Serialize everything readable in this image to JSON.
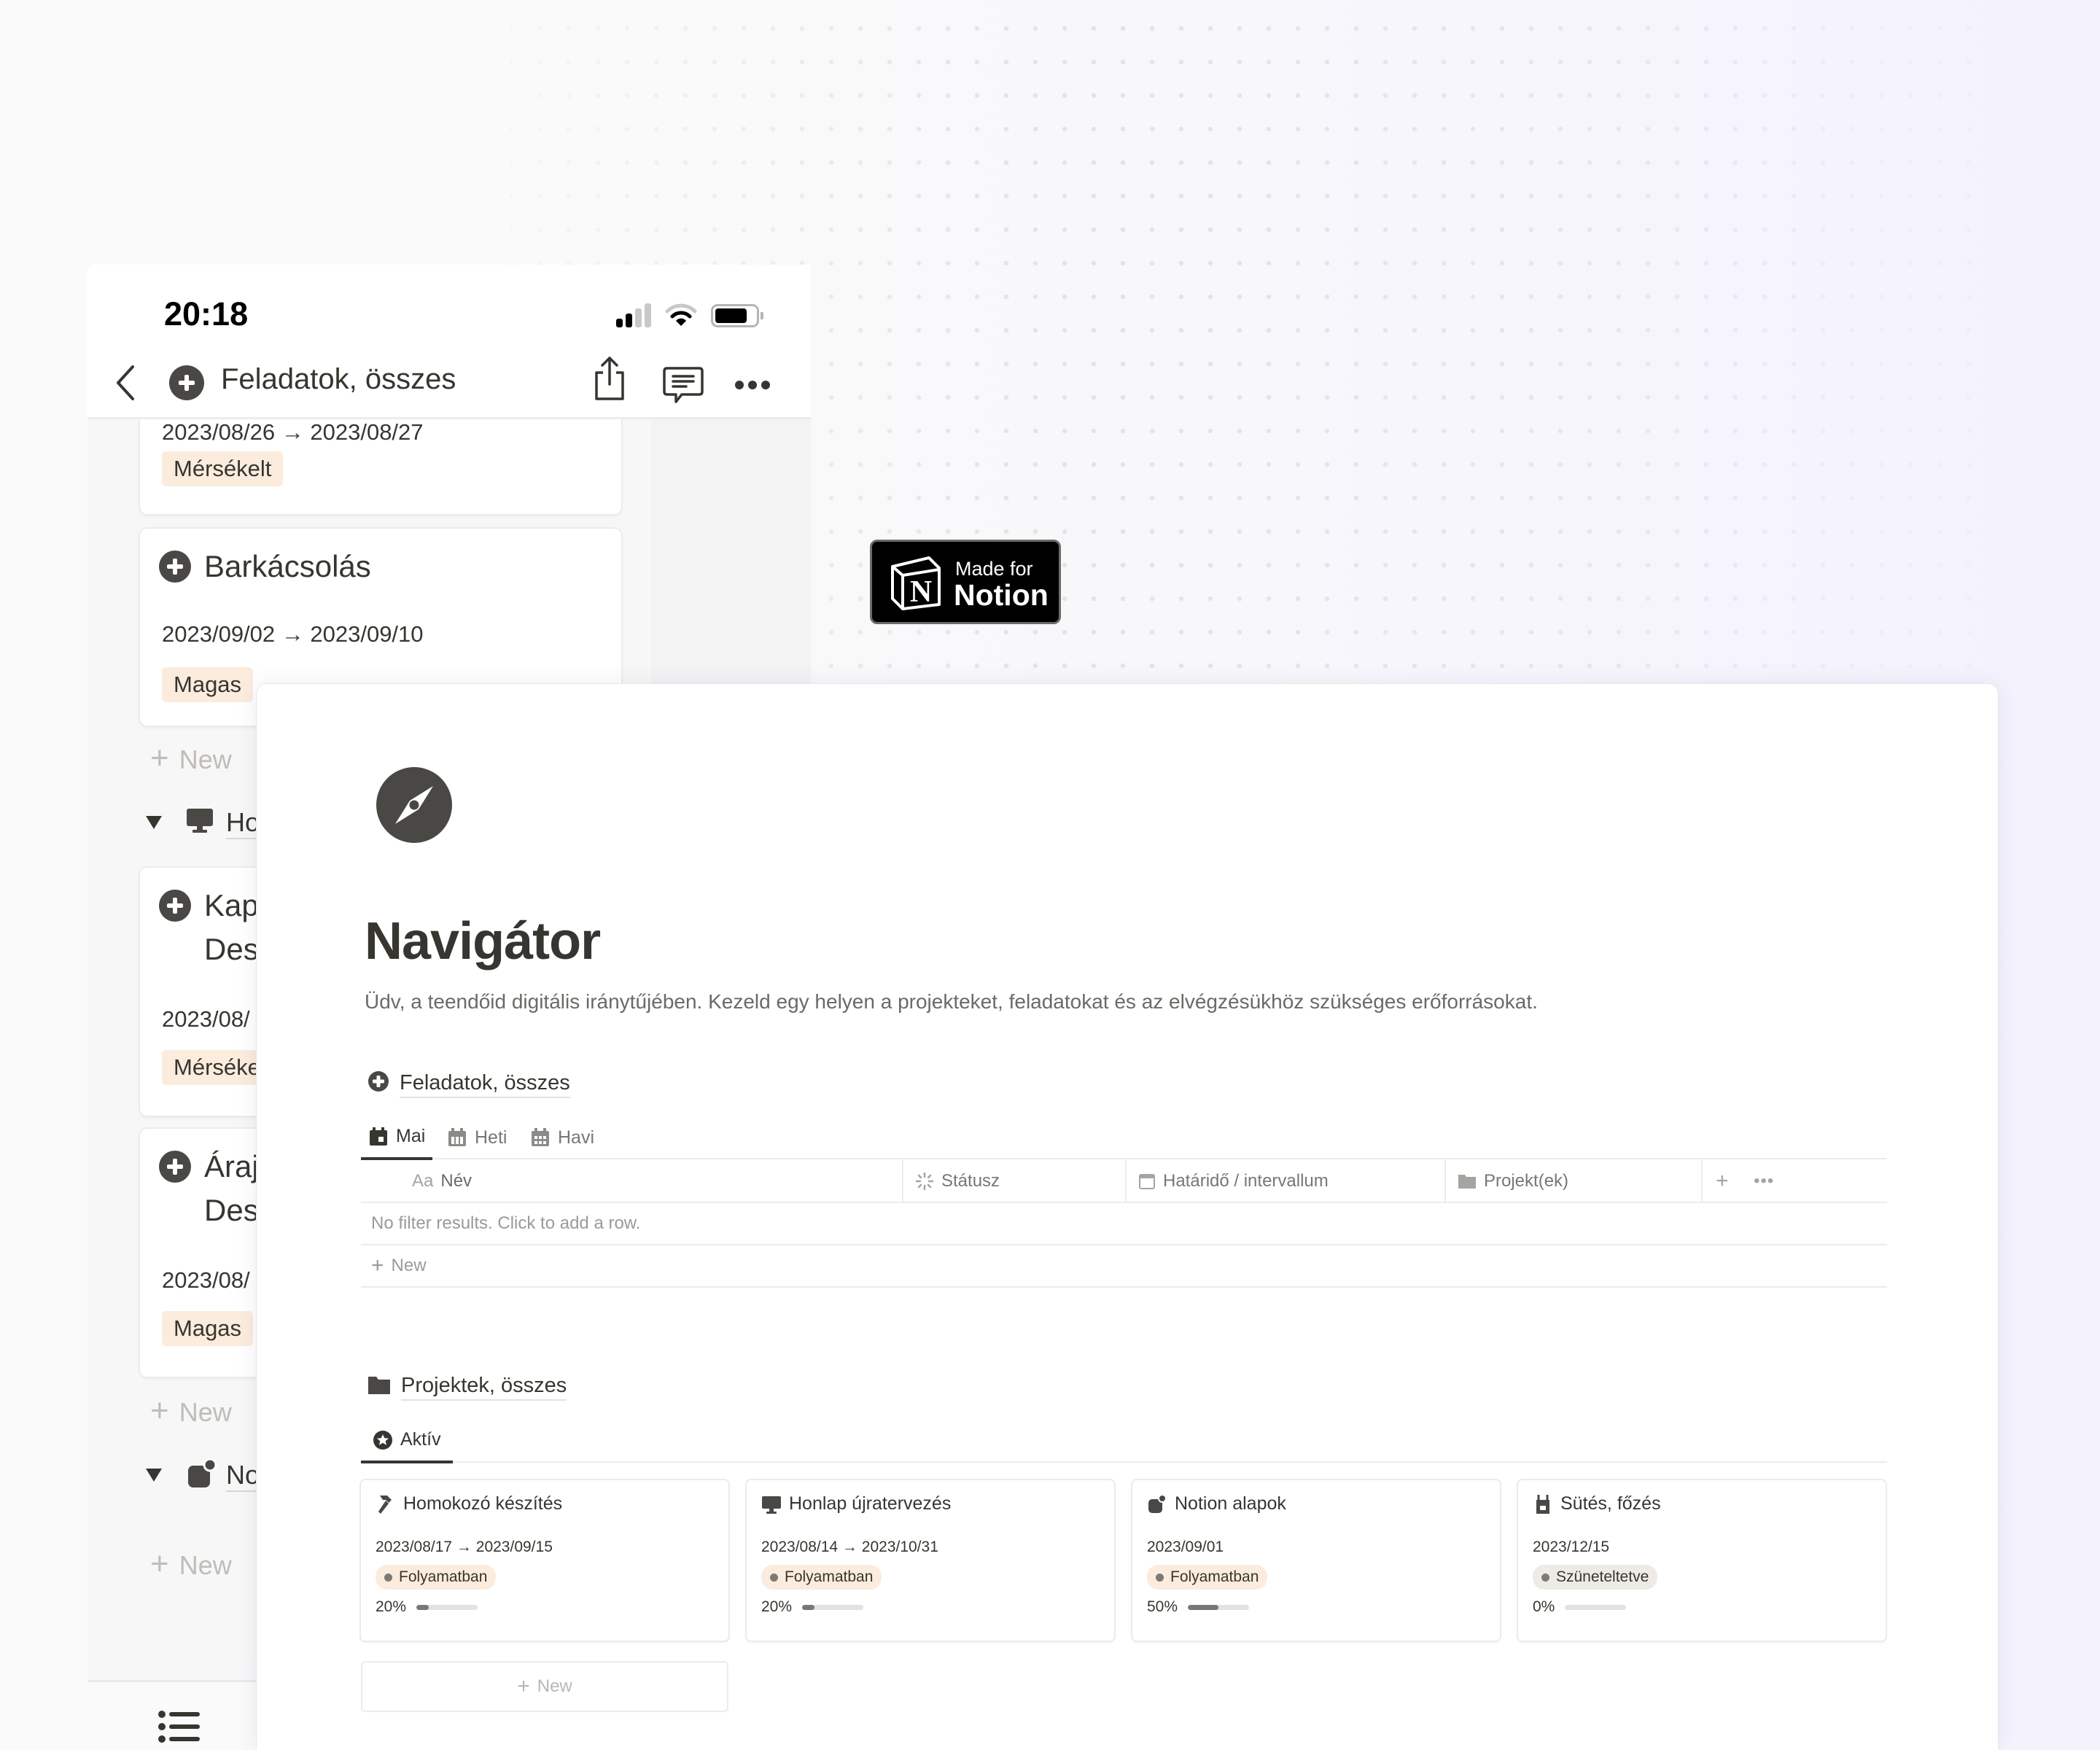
{
  "phone": {
    "status_bar": {
      "time": "20:18"
    },
    "nav": {
      "title": "Feladatok, összes"
    },
    "cards": [
      {
        "title": "",
        "date": "2023/08/26 → 2023/08/27",
        "priority": "Mérsékelt"
      },
      {
        "title": "Barkácsolás",
        "date": "2023/09/02 → 2023/09/10",
        "priority": "Magas"
      },
      {
        "title": "Kap… Des…",
        "title_line1": "Kap",
        "title_line2": "Des",
        "date": "2023/08/",
        "priority": "Mérséke"
      },
      {
        "title": "Áraj… Des…",
        "title_line1": "Áraj",
        "title_line2": "Des",
        "date": "2023/08/",
        "priority": "Magas"
      }
    ],
    "groups": [
      {
        "label": "Ho",
        "icon": "computer-icon"
      },
      {
        "label": "No",
        "icon": "notion-shapes-icon"
      }
    ],
    "new_label": "New"
  },
  "badge": {
    "line1": "Made for",
    "line2": "Notion"
  },
  "page": {
    "icon": "compass-icon",
    "title": "Navigátor",
    "description": "Üdv, a teendőid digitális iránytűjében. Kezeld egy helyen a projekteket, feladatokat és az elvégzésükhöz szükséges erőforrásokat.",
    "tasks_db": {
      "title": "Feladatok, összes",
      "tabs": [
        {
          "label": "Mai",
          "icon": "calendar-day-icon",
          "active": true
        },
        {
          "label": "Heti",
          "icon": "calendar-week-icon",
          "active": false
        },
        {
          "label": "Havi",
          "icon": "calendar-month-icon",
          "active": false
        }
      ],
      "columns": [
        {
          "label": "Név",
          "prefix": "Aa",
          "icon": "title-icon"
        },
        {
          "label": "Státusz",
          "icon": "status-icon"
        },
        {
          "label": "Határidő / intervallum",
          "icon": "calendar-icon"
        },
        {
          "label": "Projekt(ek)",
          "icon": "folder-icon"
        }
      ],
      "empty_message": "No filter results. Click to add a row.",
      "new_label": "New"
    },
    "projects_db": {
      "title": "Projektek, összes",
      "tabs": [
        {
          "label": "Aktív",
          "icon": "star-circle-icon",
          "active": true
        }
      ],
      "cards": [
        {
          "title": "Homokozó készítés",
          "icon": "hammer-icon",
          "date": "2023/08/17 → 2023/09/15",
          "status": "Folyamatban",
          "progress_label": "20%",
          "progress": 0.2
        },
        {
          "title": "Honlap újratervezés",
          "icon": "computer-icon",
          "date": "2023/08/14 → 2023/10/31",
          "status": "Folyamatban",
          "progress_label": "20%",
          "progress": 0.2
        },
        {
          "title": "Notion alapok",
          "icon": "notion-shapes-icon",
          "date": "2023/09/01",
          "status": "Folyamatban",
          "progress_label": "50%",
          "progress": 0.5
        },
        {
          "title": "Sütés, főzés",
          "icon": "apron-icon",
          "date": "2023/12/15",
          "status": "Szüneteltetve",
          "progress_label": "0%",
          "progress": 0.0
        }
      ],
      "new_label": "New"
    },
    "colors": {
      "text": "#37352f",
      "muted": "#787774",
      "tag_orange": "#fbecdd",
      "tag_gray": "#eeebe6",
      "icon_dark": "#4a4845"
    }
  }
}
